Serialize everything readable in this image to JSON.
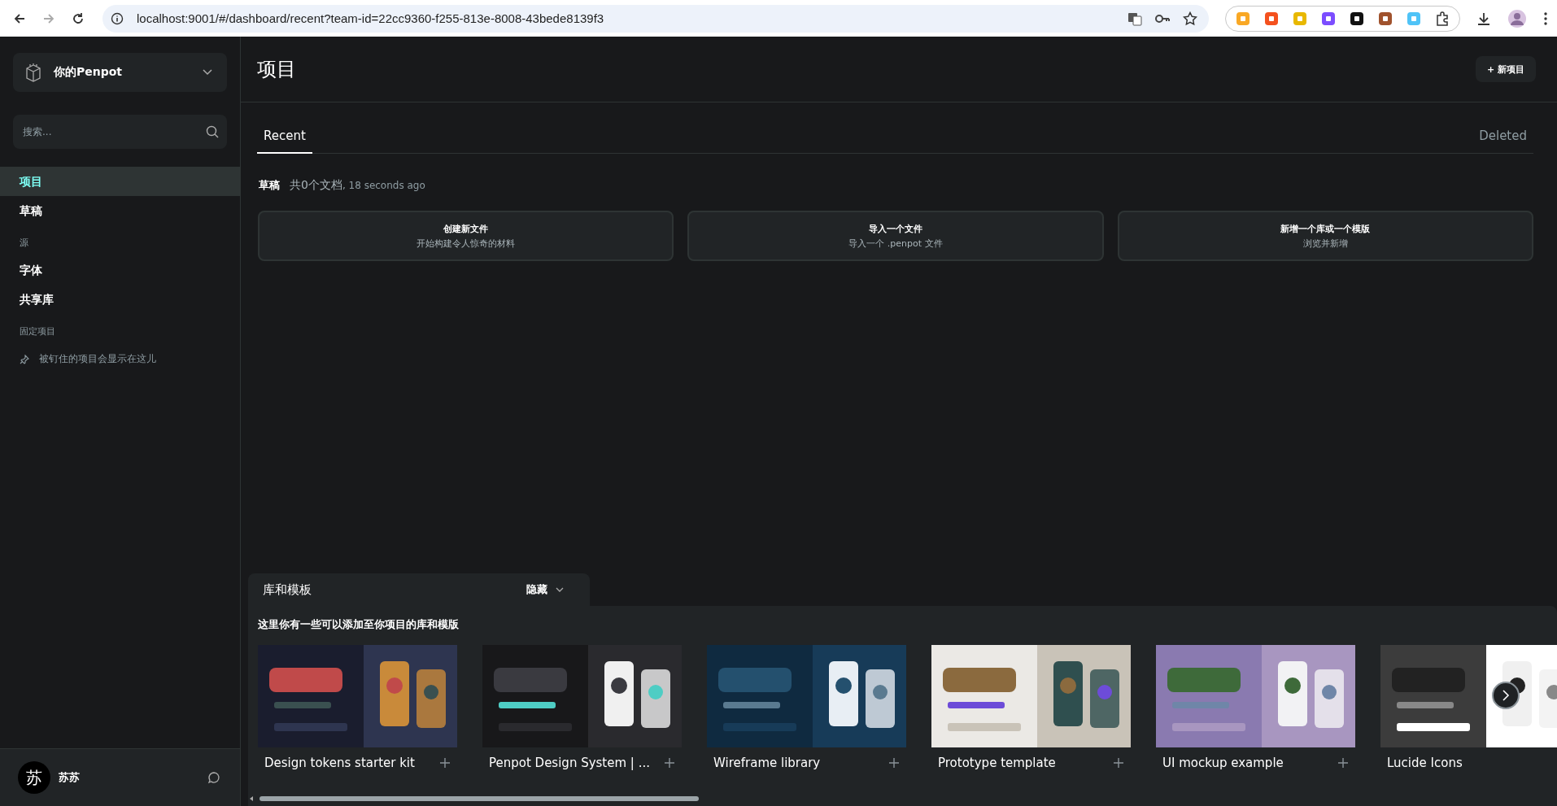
{
  "browser": {
    "url": "localhost:9001/#/dashboard/recent?team-id=22cc9360-f255-813e-8008-43bede8139f3"
  },
  "sidebar": {
    "team": {
      "name": "你的Penpot"
    },
    "search": {
      "placeholder": "搜索..."
    },
    "nav": [
      {
        "label": "项目",
        "selected": true
      },
      {
        "label": "草稿",
        "selected": false
      }
    ],
    "sources": {
      "heading": "源",
      "items": [
        {
          "label": "字体",
          "selected": false
        },
        {
          "label": "共享库",
          "selected": false
        }
      ]
    },
    "pinned": {
      "heading": "固定项目",
      "hint": "被钉住的项目会显示在这儿"
    },
    "user": {
      "initial": "苏",
      "name": "苏苏"
    }
  },
  "main": {
    "title": "项目",
    "new_button": "+ 新项目",
    "tabs": [
      {
        "label": "Recent",
        "selected": true
      },
      {
        "label": "Deleted",
        "selected": false
      }
    ],
    "drafts": {
      "title": "草稿",
      "count": "共0个文档",
      "time": ", 18 seconds ago"
    },
    "actions": [
      {
        "title": "创建新文件",
        "subtitle": "开始构建令人惊奇的材料"
      },
      {
        "title": "导入一个文件",
        "subtitle": "导入一个 .penpot 文件"
      },
      {
        "title": "新增一个库或一个模版",
        "subtitle": "浏览并新增"
      }
    ]
  },
  "templates": {
    "title": "库和模板",
    "toggle": "隐藏",
    "subtitle": "这里你有一些可以添加至你项目的库和模版",
    "items": [
      {
        "name": "Design tokens starter kit",
        "show_add": true
      },
      {
        "name": "Penpot Design System | ...",
        "show_add": true
      },
      {
        "name": "Wireframe library",
        "show_add": true
      },
      {
        "name": "Prototype template",
        "show_add": true
      },
      {
        "name": "UI mockup example",
        "show_add": true
      },
      {
        "name": "Lucide Icons",
        "show_add": false
      }
    ]
  }
}
